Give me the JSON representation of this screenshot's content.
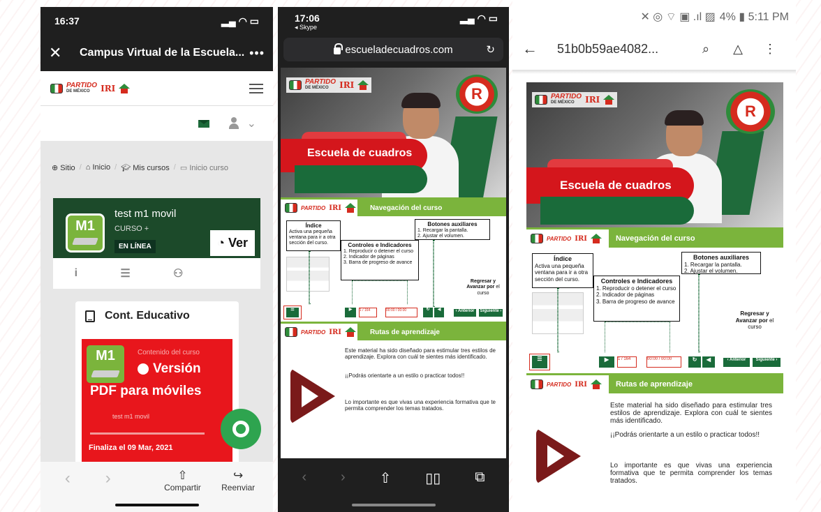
{
  "phone1": {
    "time": "16:37",
    "title": "Campus Virtual de la Escuela...",
    "breadcrumbs": [
      "Sitio",
      "Inicio",
      "Mis cursos",
      "Inicio curso"
    ],
    "course": {
      "title": "test m1 movil",
      "subtitle": "CURSO +",
      "status": "EN LÍNEA",
      "view_button": "Ver",
      "badge": "M1"
    },
    "content_card": {
      "heading": "Cont. Educativo",
      "tag": "Contenido del curso",
      "version": "Versión",
      "pdf": "PDF para móviles",
      "course_name": "test m1 movil",
      "ends": "Finaliza el 09 Mar, 2021"
    },
    "share_label": "Compartir",
    "forward_label": "Reenviar"
  },
  "phone2": {
    "time": "17:06",
    "back_app": "◂ Skype",
    "url": "escueladecuadros.com"
  },
  "phone3": {
    "status_right": "4% ▮ 5:11 PM",
    "filename": "51b0b59ae4082..."
  },
  "slides": {
    "logo_line1": "EL",
    "logo_line2": "PARTIDO",
    "logo_line3": "DE MÉXICO",
    "ipri": "IRI",
    "hero_title": "Escuela de cuadros",
    "nav_title": "Navegación del curso",
    "indice_title": "Índice",
    "indice_text": "Activa una pequeña ventana para ir a otra sección del curso.",
    "aux_title": "Botones auxiliares",
    "aux_1": "1. Recargar la pantalla.",
    "aux_2": "2. Ajustar el volumen.",
    "ctrl_title": "Controles e Indicadores",
    "ctrl_1": "1. Reproducir o detener el curso",
    "ctrl_2": "2. Indicador de páginas",
    "ctrl_3": "3. Barra de progreso de avance",
    "regresar_1": "Regresar y",
    "regresar_2": "Avanzar por",
    "regresar_3": "el curso",
    "page_ind": "1 / 164",
    "time_ind": "00:00 / 00:00",
    "btn_anterior": "‹ Anterior",
    "btn_siguiente": "Siguiente ›",
    "rutas_title": "Rutas de aprendizaje",
    "rutas_p1": "Este material ha sido diseñado para estimular tres estilos de aprendizaje. Explora con cuál te sientes más identificado.",
    "rutas_p2": "¡¡Podrás orientarte a un estilo o practicar todos!!",
    "rutas_p3": "Lo importante es que vivas una experiencia formativa que te permita comprender los temas tratados."
  }
}
